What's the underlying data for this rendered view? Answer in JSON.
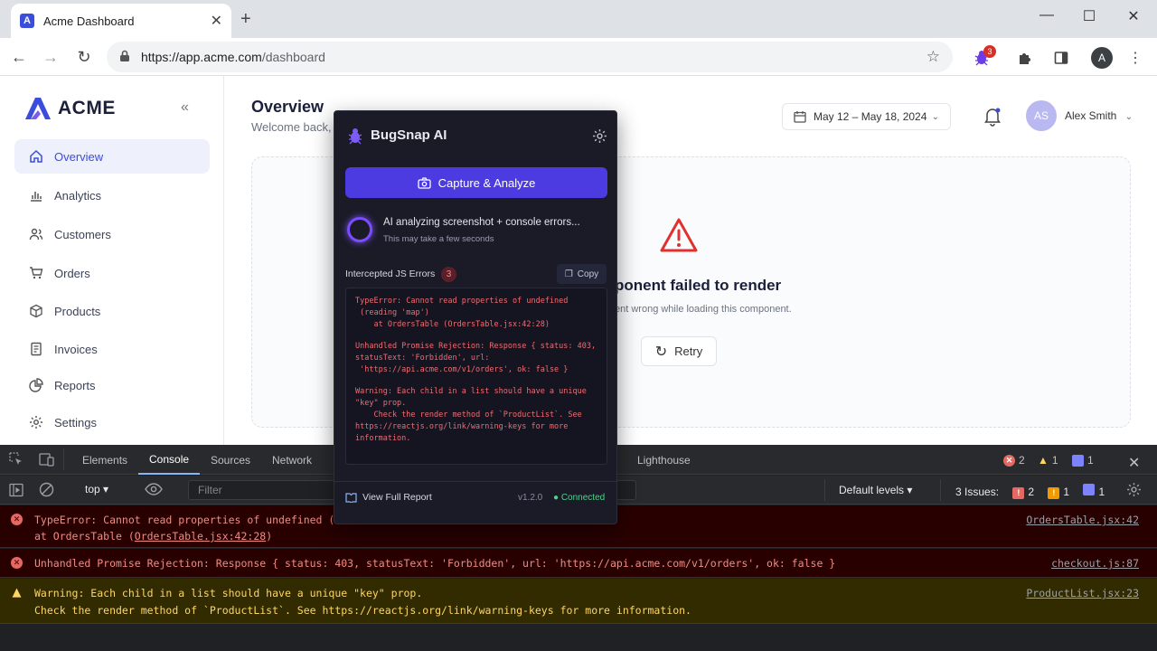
{
  "browser": {
    "tab_title": "Acme Dashboard",
    "tab_favicon": "A",
    "url_host": "https://app.acme.com",
    "url_path": "/dashboard",
    "ext_badge": "3",
    "profile_initial": "A"
  },
  "sidebar": {
    "brand": "ACME",
    "items": [
      {
        "label": "Overview",
        "icon": "home-icon",
        "active": true
      },
      {
        "label": "Analytics",
        "icon": "bar-chart-icon"
      },
      {
        "label": "Customers",
        "icon": "users-icon"
      },
      {
        "label": "Orders",
        "icon": "cart-icon"
      },
      {
        "label": "Products",
        "icon": "box-icon"
      },
      {
        "label": "Invoices",
        "icon": "document-icon"
      },
      {
        "label": "Reports",
        "icon": "pie-chart-icon"
      },
      {
        "label": "Settings",
        "icon": "gear-icon"
      }
    ]
  },
  "main": {
    "title": "Overview",
    "subtitle": "Welcome back,",
    "date_range": "May 12 – May 18, 2024",
    "user_initials": "AS",
    "user_name": "Alex Smith",
    "error_title": "ponent failed to render",
    "error_sub": "ent wrong while loading this component.",
    "retry_label": "Retry"
  },
  "popup": {
    "title": "BugSnap AI",
    "capture_label": "Capture & Analyze",
    "status": "AI analyzing screenshot + console errors...",
    "status_sub": "This may take a few seconds",
    "section_label": "Intercepted JS Errors",
    "error_count": "3",
    "copy_label": "Copy",
    "errors": [
      "TypeError: Cannot read properties of undefined\n (reading 'map')\n    at OrdersTable (OrdersTable.jsx:42:28)",
      "Unhandled Promise Rejection: Response { status: 403,\nstatusText: 'Forbidden', url:\n 'https://api.acme.com/v1/orders', ok: false }",
      "Warning: Each child in a list should have a unique\n\"key\" prop.\n    Check the render method of `ProductList`. See\nhttps://reactjs.org/link/warning-keys for more\ninformation."
    ],
    "report_label": "View Full Report",
    "version": "v1.2.0",
    "connection": "● Connected"
  },
  "devtools": {
    "tabs": [
      "Elements",
      "Console",
      "Sources",
      "Network",
      "Lighthouse"
    ],
    "active_tab": "Console",
    "context": "top",
    "filter_placeholder": "Filter",
    "levels": "Default levels",
    "issues_label": "3 Issues:",
    "counts": {
      "errors": "2",
      "warnings": "1",
      "info": "1"
    },
    "console": [
      {
        "level": "error",
        "line1": "TypeError: Cannot read properties of undefined (",
        "line2": "    at OrdersTable (",
        "link2": "OrdersTable.jsx:42:28",
        "line2_end": ")",
        "source": "OrdersTable.jsx:42"
      },
      {
        "level": "error",
        "line1": "Unhandled Promise Rejection: Response { status: 403, statusText: 'Forbidden', url: 'https://api.acme.com/v1/orders', ok: false }",
        "source": "checkout.js:87"
      },
      {
        "level": "warning",
        "line1": "Warning: Each child in a list should have a unique \"key\" prop.",
        "line2": "Check the render method of `ProductList`. See https://reactjs.org/link/warning-keys for more information.",
        "source": "ProductList.jsx:23"
      }
    ]
  },
  "colors": {
    "accent": "#3b4ddb",
    "popup_bg": "#1a1b26",
    "capture_btn": "#4b3be0",
    "error": "#f28b82",
    "warning": "#fdd663"
  }
}
